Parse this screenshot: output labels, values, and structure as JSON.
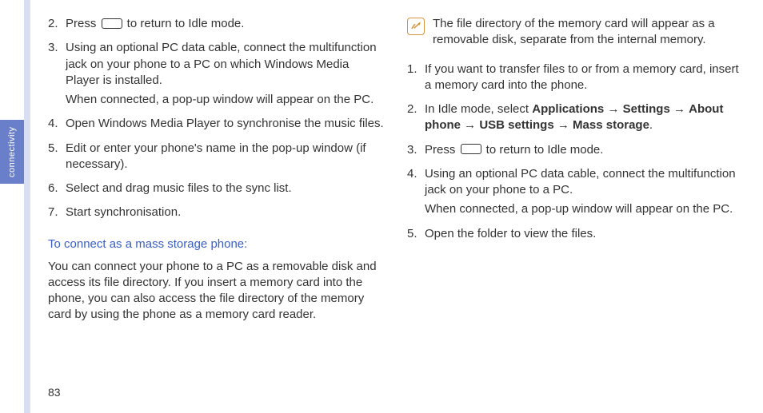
{
  "sideTab": "connectivity",
  "pageNumber": "83",
  "left": {
    "steps": [
      {
        "num": "2.",
        "pre": "Press ",
        "afterIcon": " to return to Idle mode.",
        "hasIcon": true
      },
      {
        "num": "3.",
        "line1": "Using an optional PC data cable, connect the multifunction jack on your phone to a PC on which Windows Media Player is installed.",
        "line2": "When connected, a pop-up window will appear on the PC."
      },
      {
        "num": "4.",
        "line1": "Open Windows Media Player to synchronise the music files."
      },
      {
        "num": "5.",
        "line1": "Edit or enter your phone's name in the pop-up window (if necessary)."
      },
      {
        "num": "6.",
        "line1": "Select and drag music files to the sync list."
      },
      {
        "num": "7.",
        "line1": "Start synchronisation."
      }
    ],
    "subheading": "To connect as a mass storage phone:",
    "paragraph": "You can connect your phone to a PC as a removable disk and access its file directory. If you insert a memory card into the phone, you can also access the file directory of the memory card by using the phone as a memory card reader."
  },
  "right": {
    "note": "The file directory of the memory card will appear as a removable disk, separate from the internal memory.",
    "steps": [
      {
        "num": "1.",
        "line1": "If you want to transfer files to or from a memory card, insert a memory card into the phone."
      },
      {
        "num": "2.",
        "line1Html": "In Idle mode, select <b>Applications</b> <span class='arrow'>→</span> <b>Settings</b> <span class='arrow'>→</span> <b>About phone</b> <span class='arrow'>→</span> <b>USB settings</b> <span class='arrow'>→</span> <b>Mass storage</b>."
      },
      {
        "num": "3.",
        "pre": "Press ",
        "afterIcon": " to return to Idle mode.",
        "hasIcon": true
      },
      {
        "num": "4.",
        "line1": "Using an optional PC data cable, connect the multifunction jack on your phone to a PC.",
        "line2": "When connected, a pop-up window will appear on the PC."
      },
      {
        "num": "5.",
        "line1": "Open the folder to view the files."
      }
    ]
  }
}
